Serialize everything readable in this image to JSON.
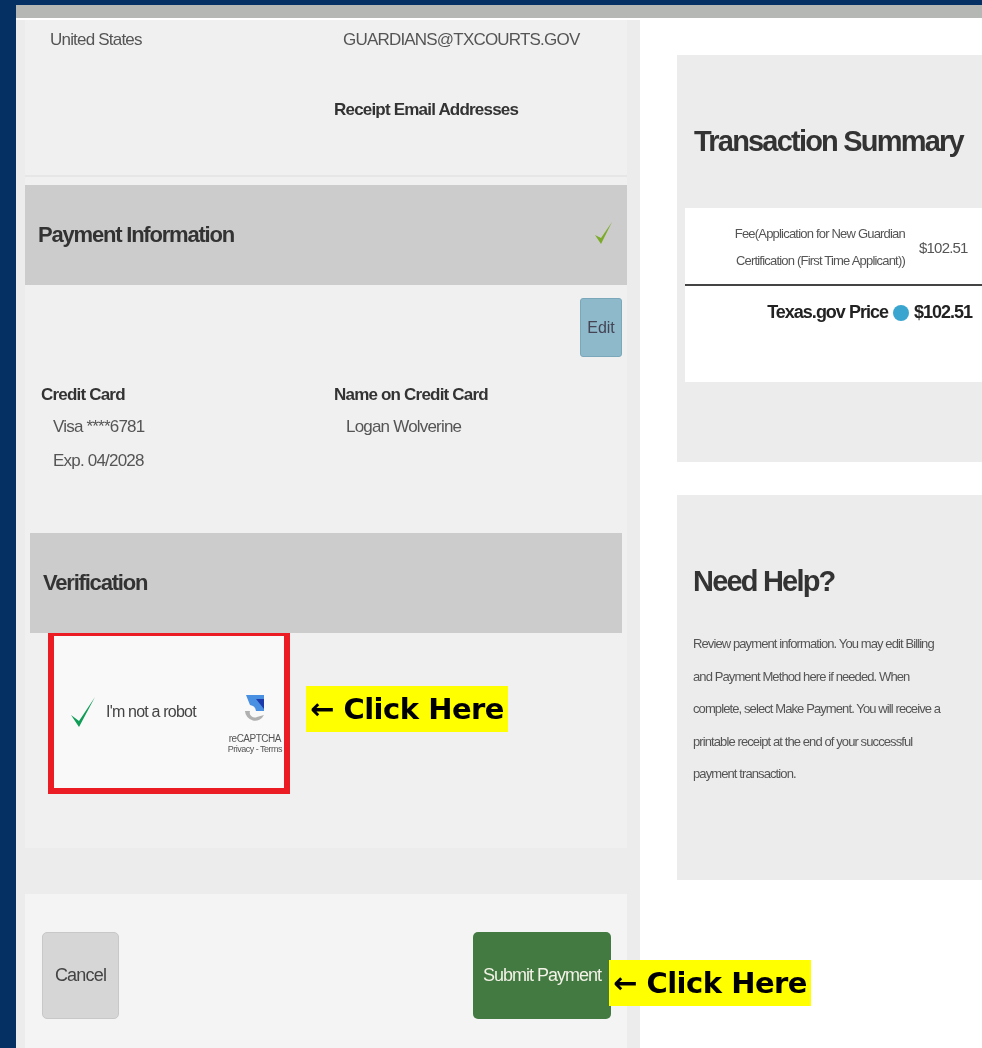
{
  "address": {
    "country": "United States",
    "email": "GUARDIANS@TXCOURTS.GOV",
    "receipt_label": "Receipt Email Addresses"
  },
  "payment_information": {
    "title": "Payment Information",
    "complete": true,
    "edit_button": "Edit",
    "credit_card_label": "Credit Card",
    "card_number": "Visa ****6781",
    "expiry": "Exp. 04/2028",
    "name_label": "Name on Credit Card",
    "name": "Logan Wolverine"
  },
  "verification": {
    "title": "Verification",
    "callout": "← Click Here",
    "captcha": {
      "checked": true,
      "label": "I'm not a robot",
      "brand": "reCAPTCHA",
      "links": "Privacy - Terms"
    }
  },
  "buttons": {
    "cancel": "Cancel",
    "submit": "Submit Payment",
    "callout": "← Click Here"
  },
  "transaction_summary": {
    "title": "Transaction Summary",
    "line_item": {
      "description": "Fee(Application for New Guardian Certification (First Time Applicant))",
      "amount": "$102.51"
    },
    "total_label": "Texas.gov Price",
    "total": "$102.51"
  },
  "help": {
    "title": "Need Help?",
    "text": "Review payment information. You may edit Billing and Payment Method here if needed. When complete, select Make Payment. You will receive a printable receipt at the end of your successful payment transaction."
  }
}
